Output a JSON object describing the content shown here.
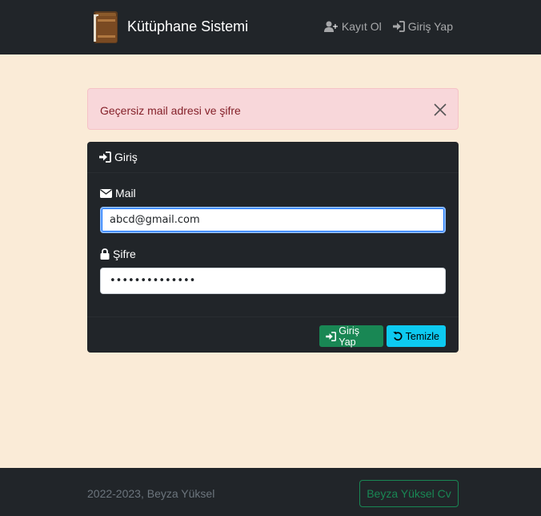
{
  "navbar": {
    "brand": "Kütüphane Sistemi",
    "links": [
      {
        "label": "Kayıt Ol",
        "icon": "user-plus-icon"
      },
      {
        "label": "Giriş Yap",
        "icon": "sign-in-icon"
      }
    ]
  },
  "alert": {
    "message": "Geçersiz mail adresi ve şifre"
  },
  "login_card": {
    "header": "Giriş",
    "mail_label": "Mail",
    "mail_value": "abcd@gmail.com",
    "password_label": "Şifre",
    "password_value": "••••••••••••••",
    "submit_label": "Giriş Yap",
    "reset_label": "Temizle"
  },
  "footer": {
    "copyright": "2022-2023, Beyza Yüksel",
    "cv_button": "Beyza Yüksel Cv"
  },
  "colors": {
    "background": "#faebd7",
    "dark": "#212529",
    "success": "#198754",
    "info": "#0dcaf0",
    "alert_bg": "#f8d7da"
  }
}
